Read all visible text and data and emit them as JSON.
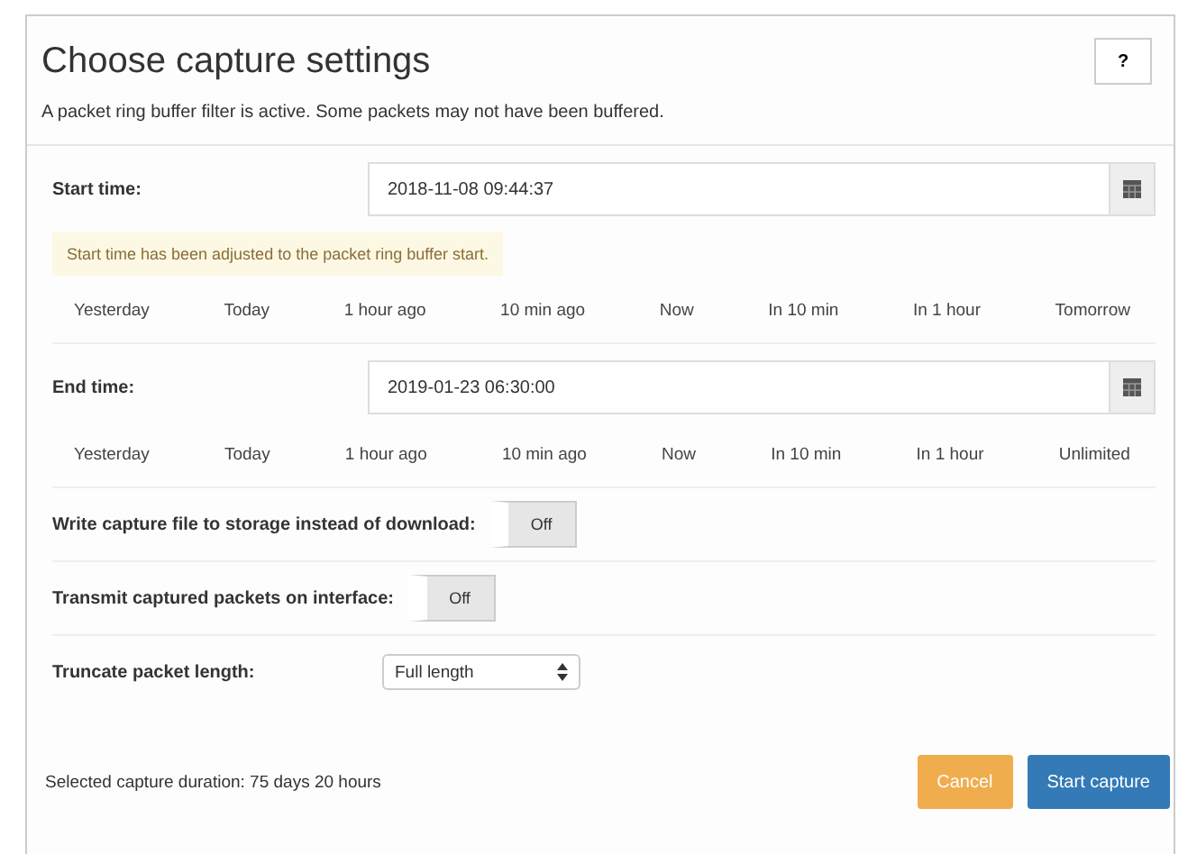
{
  "dialog": {
    "title": "Choose capture settings",
    "help_button": "?",
    "notice": "A packet ring buffer filter is active. Some packets may not have been buffered."
  },
  "start_time": {
    "label": "Start time:",
    "value": "2018-11-08 09:44:37",
    "warning": "Start time has been adjusted to the packet ring buffer start.",
    "shortcuts": [
      "Yesterday",
      "Today",
      "1 hour ago",
      "10 min ago",
      "Now",
      "In 10 min",
      "In 1 hour",
      "Tomorrow"
    ]
  },
  "end_time": {
    "label": "End time:",
    "value": "2019-01-23 06:30:00",
    "shortcuts": [
      "Yesterday",
      "Today",
      "1 hour ago",
      "10 min ago",
      "Now",
      "In 10 min",
      "In 1 hour",
      "Unlimited"
    ]
  },
  "toggles": [
    {
      "label": "Write capture file to storage instead of download:",
      "state": "Off",
      "on": false
    },
    {
      "label": "Transmit captured packets on interface:",
      "state": "Off",
      "on": false
    }
  ],
  "truncate": {
    "label": "Truncate packet length:",
    "value": "Full length"
  },
  "footer": {
    "duration": "Selected capture duration: 75 days 20 hours",
    "buttons": [
      "Cancel",
      "Start capture"
    ]
  }
}
